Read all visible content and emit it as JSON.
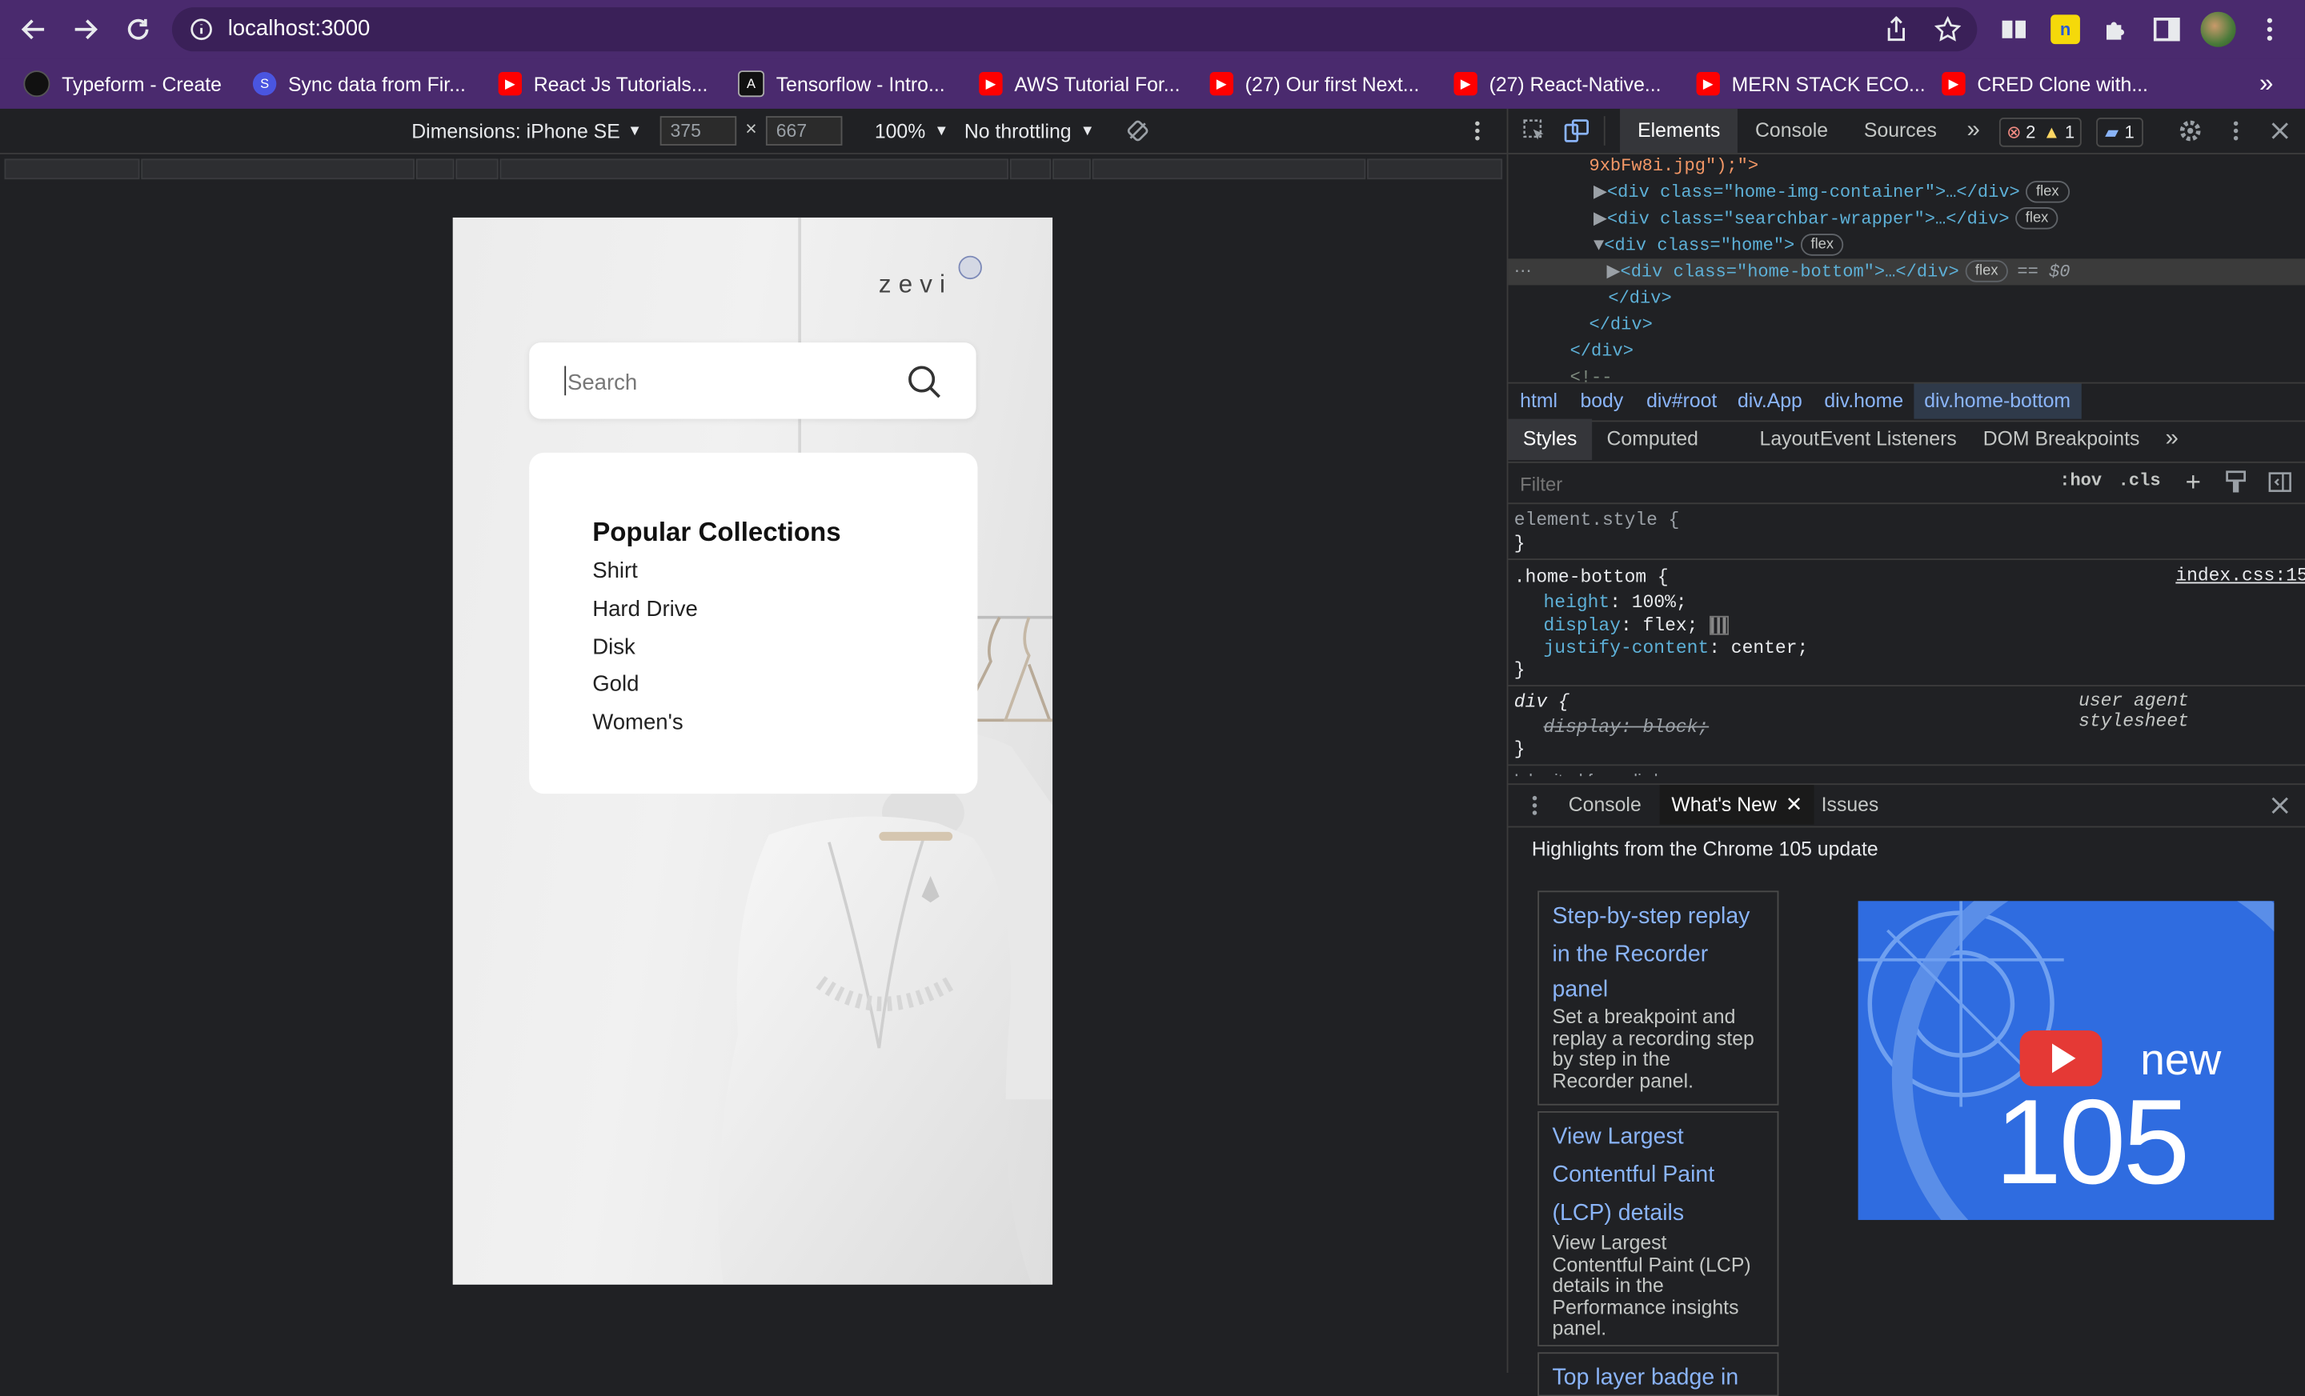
{
  "browser": {
    "url": "localhost:3000",
    "bookmarks": [
      {
        "label": "Typeform - Create",
        "icon": "typeform-icon"
      },
      {
        "label": "Sync data from Fir...",
        "icon": "sync-icon"
      },
      {
        "label": "React Js Tutorials...",
        "icon": "youtube-icon"
      },
      {
        "label": "Tensorflow - Intro...",
        "icon": "tensorflow-icon"
      },
      {
        "label": "AWS Tutorial For...",
        "icon": "youtube-icon"
      },
      {
        "label": "(27) Our first Next...",
        "icon": "youtube-icon"
      },
      {
        "label": "(27) React-Native...",
        "icon": "youtube-icon"
      },
      {
        "label": "MERN STACK ECO...",
        "icon": "youtube-icon"
      },
      {
        "label": "CRED Clone with...",
        "icon": "youtube-icon"
      }
    ],
    "more_bookmarks": "»"
  },
  "device_toolbar": {
    "dimensions_label": "Dimensions: iPhone SE",
    "width": "375",
    "height": "667",
    "times": "×",
    "zoom": "100%",
    "throttling": "No throttling"
  },
  "app": {
    "logo": "zevi",
    "search_placeholder": "Search",
    "popular_title": "Popular Collections",
    "popular_items": [
      "Shirt",
      "Hard Drive",
      "Disk",
      "Gold",
      "Women's"
    ]
  },
  "devtools": {
    "tabs": [
      "Elements",
      "Console",
      "Sources"
    ],
    "more": "»",
    "errors": "2",
    "warnings": "1",
    "messages": "1",
    "dom_lines": [
      {
        "text": "9xbFw8i.jpg\");\">"
      },
      {
        "tag_open": "<div class=\"home-img-container\">…</div>",
        "badge": "flex"
      },
      {
        "tag_open": "<div class=\"searchbar-wrapper\">…</div>",
        "badge": "flex"
      },
      {
        "tag_open": "<div class=\"home\">",
        "badge": "flex"
      },
      {
        "tag_open": "<div class=\"home-bottom\">…</div>",
        "badge": "flex",
        "suffix": "== $0"
      },
      {
        "text": "</div>"
      },
      {
        "text": "</div>"
      },
      {
        "text": "</div>"
      },
      {
        "text": "<!--"
      }
    ],
    "breadcrumbs": [
      "html",
      "body",
      "div#root",
      "div.App",
      "div.home",
      "div.home-bottom"
    ],
    "style_tabs": [
      "Styles",
      "Computed",
      "Layout",
      "Event Listeners",
      "DOM Breakpoints"
    ],
    "filter_placeholder": "Filter",
    "hov": ":hov",
    "cls": ".cls",
    "styles": {
      "element_style": "element.style {",
      "close": "}",
      "rule_selector": ".home-bottom {",
      "rule_source": "index.css:15",
      "rule_props": [
        {
          "name": "height",
          "value": "100%;"
        },
        {
          "name": "display",
          "value": "flex;"
        },
        {
          "name": "justify-content",
          "value": "center;"
        }
      ],
      "ua_selector": "div {",
      "ua_source": "user agent stylesheet",
      "ua_prop": "display: block;",
      "inherited": "Inherited from div.home"
    },
    "drawer_tabs": [
      "Console",
      "What's New",
      "Issues"
    ],
    "highlights": "Highlights from the Chrome 105 update",
    "cards": [
      {
        "title_lines": [
          "Step-by-step replay",
          "in the Recorder",
          "panel"
        ],
        "desc_lines": [
          "Set a breakpoint and",
          "replay a recording step",
          "by step in the",
          "Recorder panel."
        ]
      },
      {
        "title_lines": [
          "View Largest",
          "Contentful Paint",
          "(LCP) details"
        ],
        "desc_lines": [
          "View Largest",
          "Contentful Paint (LCP)",
          "details in the",
          "Performance insights",
          "panel."
        ]
      },
      {
        "title_lines": [
          "Top layer badge in"
        ],
        "desc_lines": []
      }
    ],
    "promo": {
      "new": "new",
      "version": "105"
    }
  }
}
